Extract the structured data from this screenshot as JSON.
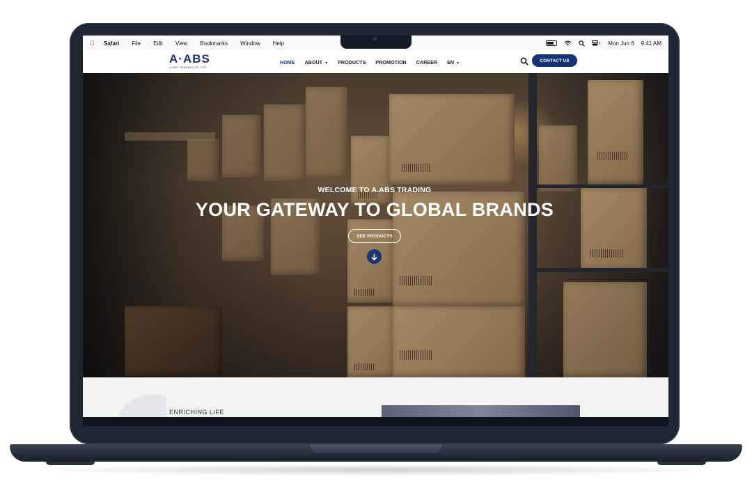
{
  "menubar": {
    "app": "Safari",
    "items": [
      "File",
      "Edit",
      "View",
      "Bookmarks",
      "Window",
      "Help"
    ],
    "date": "Mon Jun 6",
    "time": "9:41 AM"
  },
  "site": {
    "logo_text": "A·ABS",
    "logo_sub": "A.ABS TRADING CO.,LTD.",
    "nav": {
      "home": "HOME",
      "about": "ABOUT",
      "products": "PRODUCTS",
      "promotion": "PROMOTION",
      "career": "CAREER",
      "lang": "EN"
    },
    "contact": "CONTACT US"
  },
  "hero": {
    "welcome": "WELCOME TO A.ABS TRADING",
    "title": "YOUR GATEWAY TO GLOBAL BRANDS",
    "cta": "SEE PRODUCTS"
  },
  "section": {
    "partial_text": "ENRICHING LIFE"
  },
  "colors": {
    "brand_navy": "#153276",
    "laptop_body": "#1e2634"
  }
}
